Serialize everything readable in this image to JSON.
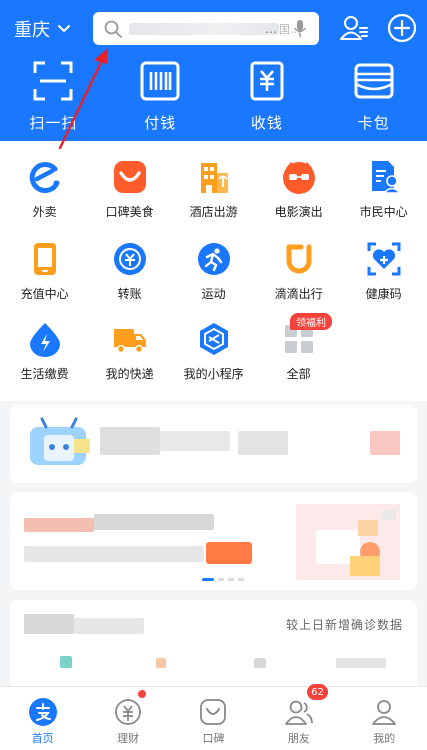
{
  "header": {
    "city": "重庆",
    "search_placeholder": "…",
    "search_hint": "国…",
    "big_actions": [
      {
        "label": "扫一扫",
        "icon": "scan-icon"
      },
      {
        "label": "付钱",
        "icon": "barcode-icon"
      },
      {
        "label": "收钱",
        "icon": "yuan-receipt-icon"
      },
      {
        "label": "卡包",
        "icon": "wallet-icon"
      }
    ]
  },
  "grid": {
    "items": [
      {
        "label": "外卖",
        "icon": "eleme-icon"
      },
      {
        "label": "口碑美食",
        "icon": "koubei-food-icon"
      },
      {
        "label": "酒店出游",
        "icon": "hotel-icon"
      },
      {
        "label": "电影演出",
        "icon": "movie-icon"
      },
      {
        "label": "市民中心",
        "icon": "citizen-center-icon"
      },
      {
        "label": "充值中心",
        "icon": "phone-recharge-icon"
      },
      {
        "label": "转账",
        "icon": "transfer-icon"
      },
      {
        "label": "运动",
        "icon": "sport-icon"
      },
      {
        "label": "滴滴出行",
        "icon": "didi-icon"
      },
      {
        "label": "健康码",
        "icon": "health-code-icon"
      },
      {
        "label": "生活缴费",
        "icon": "utility-icon"
      },
      {
        "label": "我的快递",
        "icon": "express-truck-icon"
      },
      {
        "label": "我的小程序",
        "icon": "mini-program-icon"
      },
      {
        "label": "全部",
        "icon": "all-apps-icon"
      }
    ],
    "all_badge": "领福利"
  },
  "card3": {
    "note": "较上日新增确诊数据"
  },
  "tabbar": {
    "tabs": [
      {
        "label": "首页",
        "icon": "alipay-home-icon"
      },
      {
        "label": "理财",
        "icon": "wealth-icon"
      },
      {
        "label": "口碑",
        "icon": "koubei-icon"
      },
      {
        "label": "朋友",
        "icon": "friends-icon"
      },
      {
        "label": "我的",
        "icon": "my-icon"
      }
    ],
    "friends_badge": "62"
  },
  "colors": {
    "brand_blue": "#1a77ff",
    "badge_red": "#f5423d",
    "annotation_red": "#e8202a"
  }
}
